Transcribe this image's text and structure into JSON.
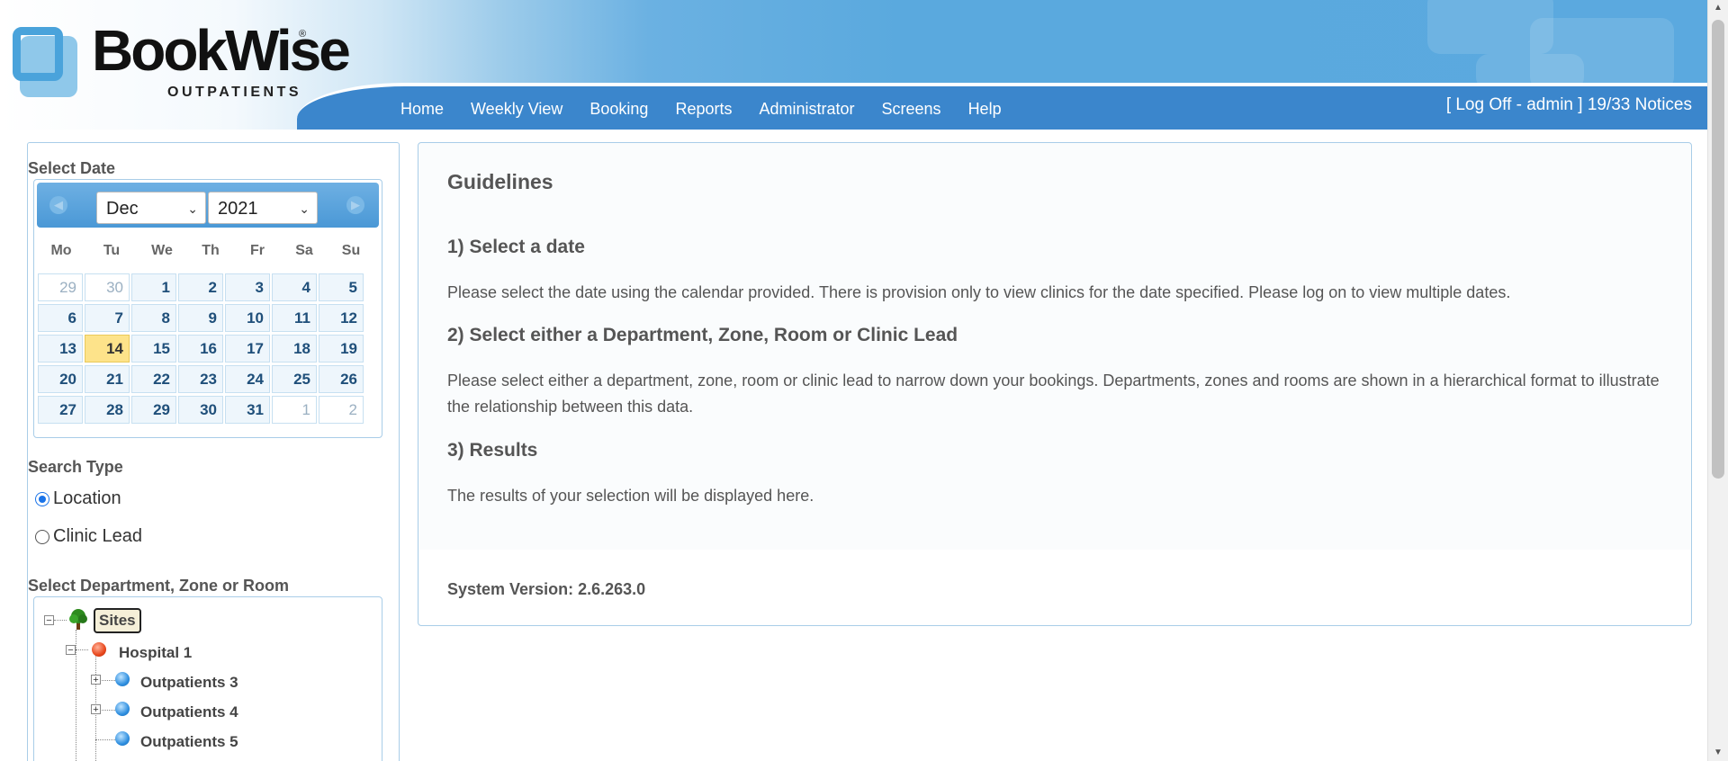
{
  "header": {
    "logo_text": "BookWise",
    "logo_registered": "®",
    "logo_subtitle": "OUTPATIENTS",
    "nav": [
      "Home",
      "Weekly View",
      "Booking",
      "Reports",
      "Administrator",
      "Screens",
      "Help"
    ],
    "user_bar": "[ Log Off - admin ] 19/33 Notices"
  },
  "sidebar": {
    "select_date_title": "Select Date",
    "calendar": {
      "month": "Dec",
      "year": "2021",
      "prev_icon": "◀",
      "next_icon": "▶",
      "weekdays": [
        "Mo",
        "Tu",
        "We",
        "Th",
        "Fr",
        "Sa",
        "Su"
      ],
      "days": [
        {
          "d": "29",
          "other": true
        },
        {
          "d": "30",
          "other": true
        },
        {
          "d": "1"
        },
        {
          "d": "2"
        },
        {
          "d": "3"
        },
        {
          "d": "4"
        },
        {
          "d": "5"
        },
        {
          "d": "6"
        },
        {
          "d": "7"
        },
        {
          "d": "8"
        },
        {
          "d": "9"
        },
        {
          "d": "10"
        },
        {
          "d": "11"
        },
        {
          "d": "12"
        },
        {
          "d": "13"
        },
        {
          "d": "14",
          "today": true
        },
        {
          "d": "15"
        },
        {
          "d": "16"
        },
        {
          "d": "17"
        },
        {
          "d": "18"
        },
        {
          "d": "19"
        },
        {
          "d": "20"
        },
        {
          "d": "21"
        },
        {
          "d": "22"
        },
        {
          "d": "23"
        },
        {
          "d": "24"
        },
        {
          "d": "25"
        },
        {
          "d": "26"
        },
        {
          "d": "27"
        },
        {
          "d": "28"
        },
        {
          "d": "29"
        },
        {
          "d": "30"
        },
        {
          "d": "31"
        },
        {
          "d": "1",
          "other": true
        },
        {
          "d": "2",
          "other": true
        }
      ]
    },
    "search_type_title": "Search Type",
    "search_options": [
      {
        "label": "Location",
        "checked": true
      },
      {
        "label": "Clinic Lead",
        "checked": false
      }
    ],
    "tree_title": "Select Department, Zone or Room",
    "tree": {
      "root": "Sites",
      "hospital": "Hospital 1",
      "children": [
        "Outpatients 3",
        "Outpatients 4",
        "Outpatients 5"
      ]
    }
  },
  "main": {
    "title": "Guidelines",
    "steps": [
      {
        "heading": "1) Select a date",
        "text": "Please select the date using the calendar provided. There is provision only to view clinics for the date specified. Please log on to view multiple dates."
      },
      {
        "heading": "2) Select either a Department, Zone, Room or Clinic Lead",
        "text": "Please select either a department, zone, room or clinic lead to narrow down your bookings. Departments, zones and rooms are shown in a hierarchical format to illustrate the relationship between this data."
      },
      {
        "heading": "3) Results",
        "text": "The results of your selection will be displayed here."
      }
    ],
    "version": "System Version: 2.6.263.0"
  },
  "colors": {
    "nav_bar": "#3b86cc",
    "panel_border": "#a9cde8",
    "today_highlight": "#fde38a",
    "radio_accent": "#1a73e8"
  }
}
